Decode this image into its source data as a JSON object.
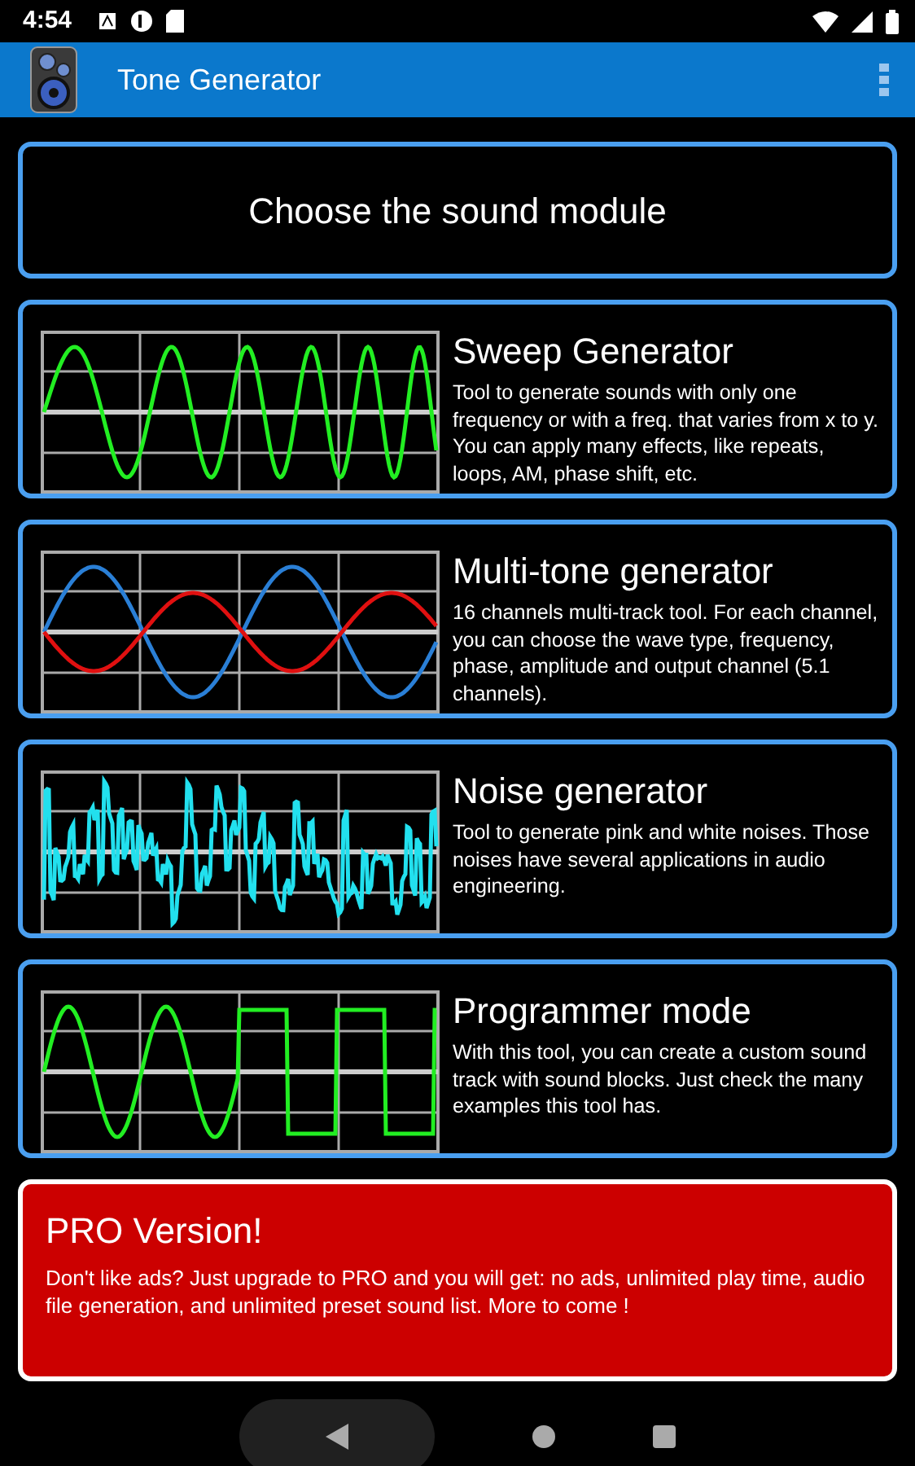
{
  "status_bar": {
    "time": "4:54"
  },
  "app_bar": {
    "title": "Tone Generator"
  },
  "header": {
    "title": "Choose the sound module"
  },
  "modules": [
    {
      "kind": "sweep",
      "title": "Sweep Generator",
      "description": "Tool to generate sounds with only one frequency or with a freq. that varies from x to y. You can apply many effects, like repeats, loops, AM, phase shift, etc."
    },
    {
      "kind": "multitone",
      "title": "Multi-tone generator",
      "description": "16 channels multi-track tool. For each channel, you can choose the wave type, frequency, phase, amplitude and output channel (5.1 channels)."
    },
    {
      "kind": "noise",
      "title": "Noise generator",
      "description": "Tool to generate pink and white noises. Those noises have several applications in audio engineering."
    },
    {
      "kind": "program",
      "title": "Programmer mode",
      "description": "With this tool, you can create a custom sound track with sound blocks. Just check the many examples this tool has."
    }
  ],
  "pro": {
    "title": "PRO Version!",
    "description": "Don't like ads? Just upgrade to PRO and you will get: no ads, unlimited play time, audio file generation, and unlimited preset sound list. More to come !"
  }
}
